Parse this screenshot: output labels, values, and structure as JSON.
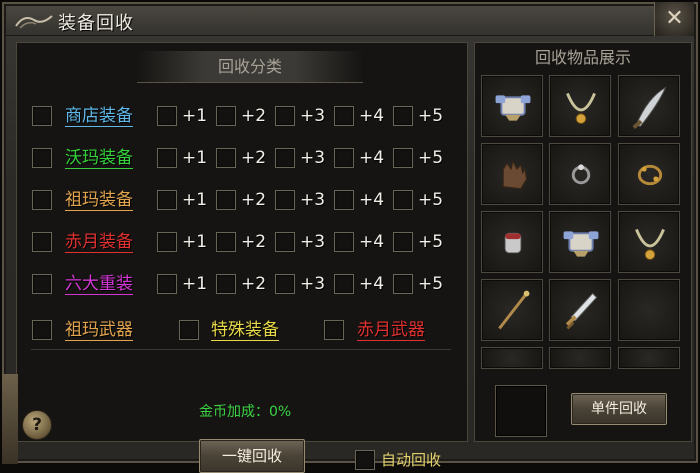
{
  "window": {
    "title": "装备回收",
    "close_glyph": "✕"
  },
  "left": {
    "header": "回收分类",
    "categories": [
      {
        "label": "商店装备",
        "color": "#5fb7e8",
        "levels": [
          "+1",
          "+2",
          "+3",
          "+4",
          "+5"
        ]
      },
      {
        "label": "沃玛装备",
        "color": "#33d13a",
        "levels": [
          "+1",
          "+2",
          "+3",
          "+4",
          "+5"
        ]
      },
      {
        "label": "祖玛装备",
        "color": "#e2a44e",
        "levels": [
          "+1",
          "+2",
          "+3",
          "+4",
          "+5"
        ]
      },
      {
        "label": "赤月装备",
        "color": "#e03030",
        "levels": [
          "+1",
          "+2",
          "+3",
          "+4",
          "+5"
        ]
      },
      {
        "label": "六大重装",
        "color": "#d436d6",
        "levels": [
          "+1",
          "+2",
          "+3",
          "+4",
          "+5"
        ]
      }
    ],
    "special": [
      {
        "label": "祖玛武器",
        "color": "#e2a44e"
      },
      {
        "label": "特殊装备",
        "color": "#e8d94a"
      },
      {
        "label": "赤月武器",
        "color": "#e03030"
      }
    ],
    "gold_bonus": "金币加成：0%",
    "one_key_button": "一键回收",
    "auto_recycle": "自动回收",
    "help": "?"
  },
  "right": {
    "header": "回收物品展示",
    "items": [
      "armor-icon",
      "necklace-icon",
      "scimitar-icon",
      "glove-icon",
      "ring-icon",
      "bracelet-icon",
      "bracer-icon",
      "armor-icon",
      "necklace-icon",
      "staff-icon",
      "sword-icon",
      "empty"
    ],
    "single_button": "单件回收"
  }
}
